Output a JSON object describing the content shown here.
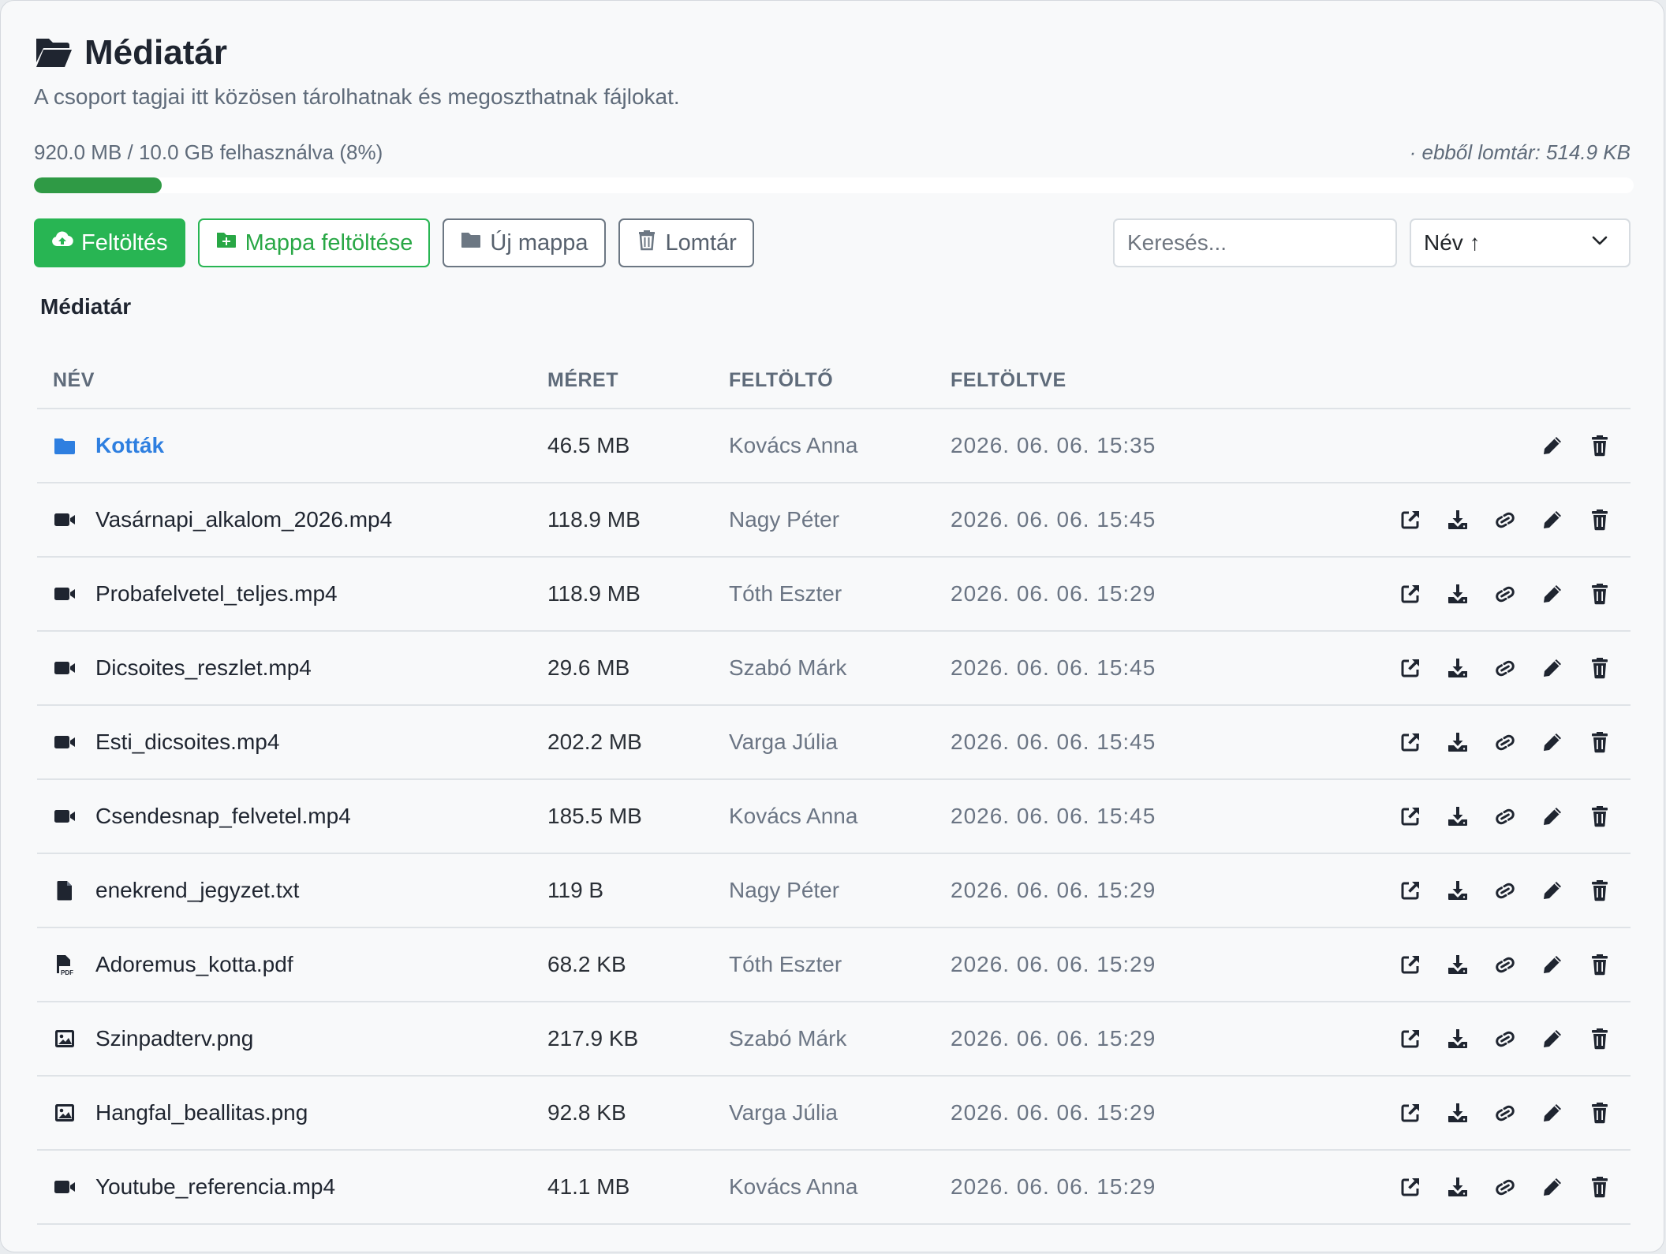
{
  "header": {
    "title": "Médiatár",
    "subtitle": "A csoport tagjai itt közösen tárolhatnak és megoszthatnak fájlokat."
  },
  "storage": {
    "usage_text": "920.0 MB / 10.0 GB felhasználva (8%)",
    "trash_text": "· ebből lomtár: 514.9 KB",
    "percent_used": 8,
    "bar_color": "#2f9a45"
  },
  "toolbar": {
    "upload_label": "Feltöltés",
    "folder_upload_label": "Mappa feltöltése",
    "new_folder_label": "Új mappa",
    "trash_label": "Lomtár",
    "search_placeholder": "Keresés...",
    "sort_value": "Név ↑"
  },
  "breadcrumb": "Médiatár",
  "table": {
    "headers": {
      "name": "NÉV",
      "size": "MÉRET",
      "uploader": "FELTÖLTŐ",
      "uploaded": "FELTÖLTVE"
    },
    "rows": [
      {
        "type": "folder",
        "icon": "folder-icon",
        "name": "Kották",
        "size": "46.5 MB",
        "uploader": "Kovács Anna",
        "uploaded": "2026. 06. 06. 15:35"
      },
      {
        "type": "video",
        "icon": "video-icon",
        "name": "Vasárnapi_alkalom_2026.mp4",
        "size": "118.9 MB",
        "uploader": "Nagy Péter",
        "uploaded": "2026. 06. 06. 15:45"
      },
      {
        "type": "video",
        "icon": "video-icon",
        "name": "Probafelvetel_teljes.mp4",
        "size": "118.9 MB",
        "uploader": "Tóth Eszter",
        "uploaded": "2026. 06. 06. 15:29"
      },
      {
        "type": "video",
        "icon": "video-icon",
        "name": "Dicsoites_reszlet.mp4",
        "size": "29.6 MB",
        "uploader": "Szabó Márk",
        "uploaded": "2026. 06. 06. 15:45"
      },
      {
        "type": "video",
        "icon": "video-icon",
        "name": "Esti_dicsoites.mp4",
        "size": "202.2 MB",
        "uploader": "Varga Júlia",
        "uploaded": "2026. 06. 06. 15:45"
      },
      {
        "type": "video",
        "icon": "video-icon",
        "name": "Csendesnap_felvetel.mp4",
        "size": "185.5 MB",
        "uploader": "Kovács Anna",
        "uploaded": "2026. 06. 06. 15:45"
      },
      {
        "type": "text",
        "icon": "text-file-icon",
        "name": "enekrend_jegyzet.txt",
        "size": "119 B",
        "uploader": "Nagy Péter",
        "uploaded": "2026. 06. 06. 15:29"
      },
      {
        "type": "pdf",
        "icon": "pdf-file-icon",
        "name": "Adoremus_kotta.pdf",
        "size": "68.2 KB",
        "uploader": "Tóth Eszter",
        "uploaded": "2026. 06. 06. 15:29"
      },
      {
        "type": "image",
        "icon": "image-icon",
        "name": "Szinpadterv.png",
        "size": "217.9 KB",
        "uploader": "Szabó Márk",
        "uploaded": "2026. 06. 06. 15:29"
      },
      {
        "type": "image",
        "icon": "image-icon",
        "name": "Hangfal_beallitas.png",
        "size": "92.8 KB",
        "uploader": "Varga Júlia",
        "uploaded": "2026. 06. 06. 15:29"
      },
      {
        "type": "video",
        "icon": "video-icon",
        "name": "Youtube_referencia.mp4",
        "size": "41.1 MB",
        "uploader": "Kovács Anna",
        "uploaded": "2026. 06. 06. 15:29"
      }
    ]
  }
}
